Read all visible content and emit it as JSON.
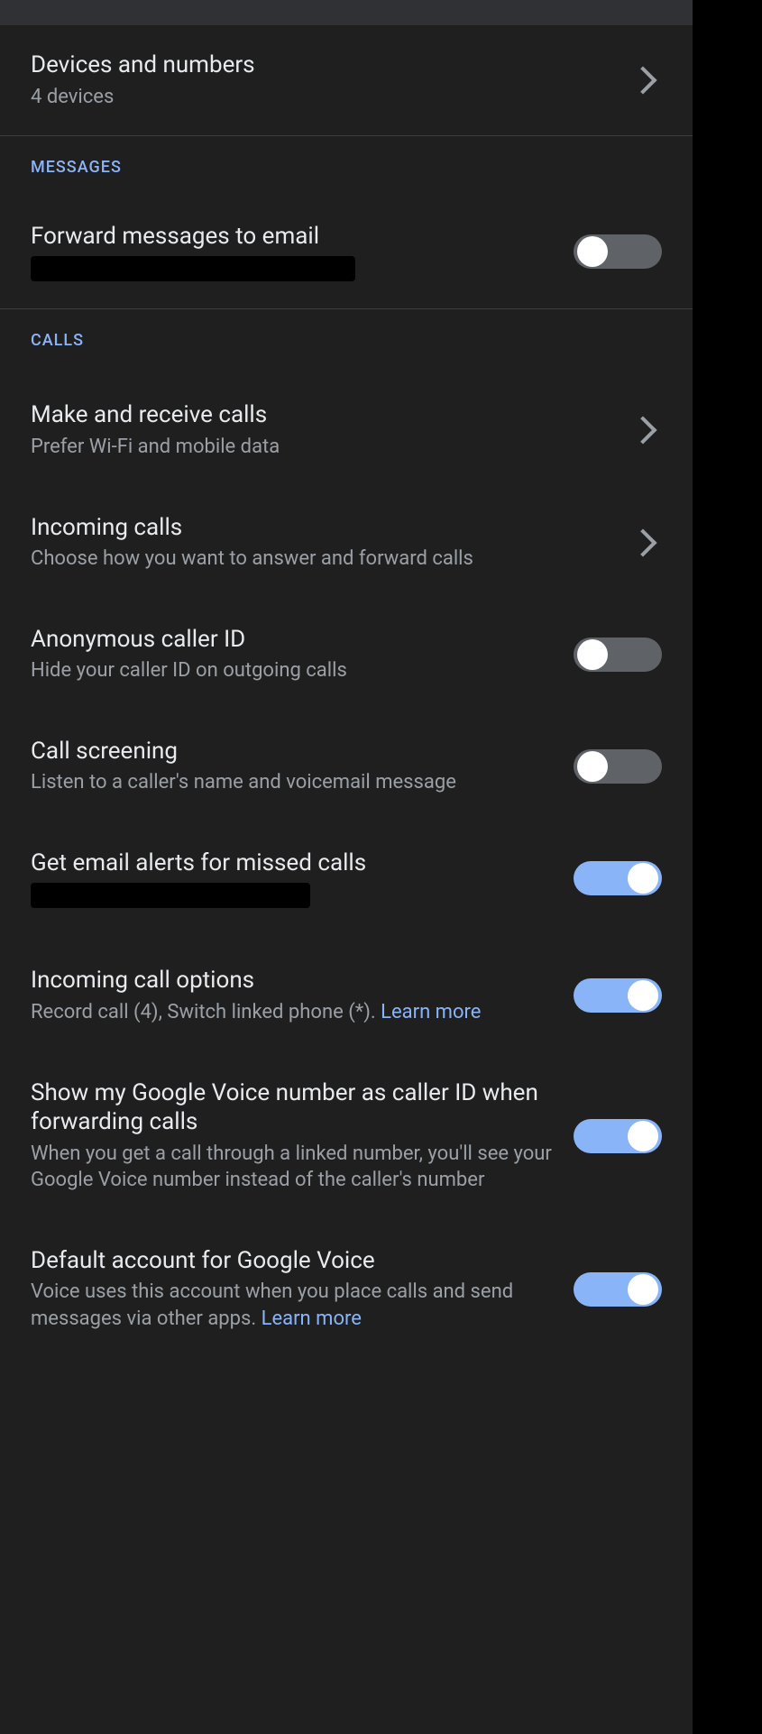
{
  "devices": {
    "title": "Devices and numbers",
    "sub": "4 devices"
  },
  "sections": {
    "messages": "MESSAGES",
    "calls": "CALLS"
  },
  "messages": {
    "forward": {
      "title": "Forward messages to email",
      "on": false
    }
  },
  "calls": {
    "make": {
      "title": "Make and receive calls",
      "sub": "Prefer Wi-Fi and mobile data"
    },
    "incoming": {
      "title": "Incoming calls",
      "sub": "Choose how you want to answer and forward calls"
    },
    "anon": {
      "title": "Anonymous caller ID",
      "sub": "Hide your caller ID on outgoing calls",
      "on": false
    },
    "screening": {
      "title": "Call screening",
      "sub": "Listen to a caller's name and voicemail message",
      "on": false
    },
    "email_alerts": {
      "title": "Get email alerts for missed calls",
      "on": true
    },
    "options": {
      "title": "Incoming call options",
      "sub_pre": "Record call (4), Switch linked phone (*). ",
      "link": "Learn more",
      "on": true
    },
    "caller_id": {
      "title": "Show my Google Voice number as caller ID when forwarding calls",
      "sub": "When you get a call through a linked number, you'll see your Google Voice number instead of the caller's number",
      "on": true
    },
    "default_acct": {
      "title": "Default account for Google Voice",
      "sub_pre": "Voice uses this account when you place calls and send messages via other apps. ",
      "link": "Learn more",
      "on": true
    }
  }
}
